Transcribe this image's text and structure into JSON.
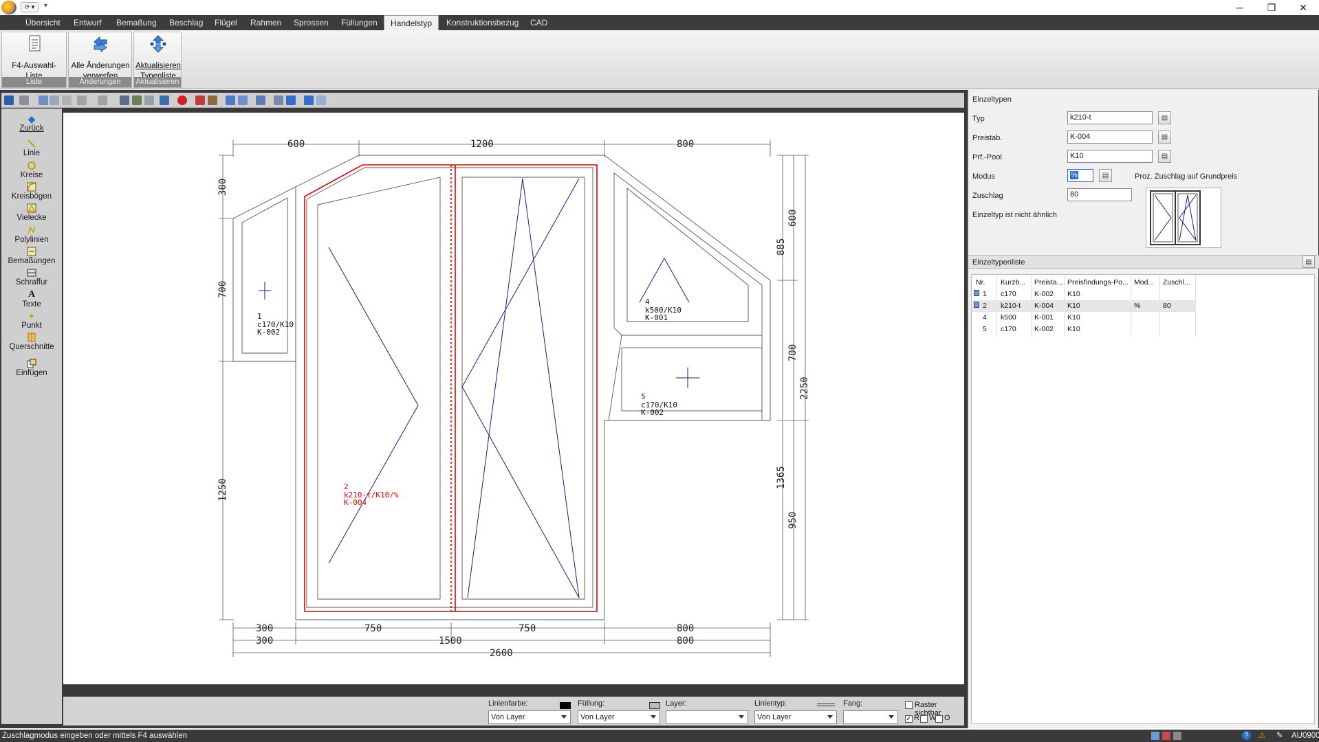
{
  "window": {
    "minimize": "─",
    "maximize": "❐",
    "close": "✕"
  },
  "quick_access": {
    "label": "⟳ ▾",
    "more": "▾"
  },
  "menu": {
    "tabs": [
      "Übersicht",
      "Entwurf",
      "Bemaßung",
      "Beschlag",
      "Flügel",
      "Rahmen",
      "Sprossen",
      "Füllungen",
      "Handelstyp",
      "Konstruktionsbezug",
      "CAD"
    ],
    "active": "Handelstyp"
  },
  "ribbon": {
    "groups": [
      {
        "caption": "Liste",
        "buttons": [
          {
            "label": "F4-Auswahl-Liste",
            "icon": "list-icon"
          }
        ]
      },
      {
        "caption": "Änderungen",
        "buttons": [
          {
            "label1": "Alle Änderungen",
            "label2": "verwerfen",
            "icon": "undo-arrows-icon"
          }
        ]
      },
      {
        "caption": "Aktualisieren",
        "buttons": [
          {
            "label1": "Aktualisieren",
            "label2": "Typenliste",
            "icon": "refresh-icon"
          }
        ]
      }
    ]
  },
  "left_tools": {
    "back": "Zurück",
    "items": [
      "Linie",
      "Kreise",
      "Kreisbögen",
      "Vielecke",
      "Polylinien",
      "Bemaßungen",
      "Schraffur",
      "Texte",
      "Punkt",
      "Querschnitte",
      "Einfügen"
    ]
  },
  "drawing": {
    "dims_top": [
      "600",
      "1200",
      "800"
    ],
    "dims_bottom1": [
      "300",
      "750",
      "750",
      "800"
    ],
    "dims_bottom2": [
      "300",
      "1500",
      "800"
    ],
    "dims_bottom3": "2600",
    "dims_left": [
      "300",
      "700",
      "1250"
    ],
    "dims_right1": [
      "600",
      "885",
      "700",
      "1365",
      "950"
    ],
    "dims_right2": "2250",
    "labels": [
      {
        "nr": "1",
        "type": "c170/K10",
        "price": "K-002"
      },
      {
        "nr": "2",
        "type": "k210-t/K10/%",
        "price": "K-004"
      },
      {
        "nr": "4",
        "type": "k500/K10",
        "price": "K-001"
      },
      {
        "nr": "5",
        "type": "c170/K10",
        "price": "K-002"
      }
    ]
  },
  "props": {
    "linienfarbe_label": "Linienfarbe:",
    "linienfarbe_value": "Von Layer",
    "fuellung_label": "Füllung:",
    "fuellung_value": "Von Layer",
    "layer_label": "Layer:",
    "layer_value": "",
    "linientyp_label": "Linientyp:",
    "linientyp_value": "Von Layer",
    "fang_label": "Fang:",
    "fang_value": "",
    "raster_label": "Raster sichtbar",
    "r": "R",
    "w": "W",
    "o": "O"
  },
  "einzeltypen": {
    "title": "Einzeltypen",
    "typ_label": "Typ",
    "typ_value": "k210-t",
    "preistab_label": "Preistab.",
    "preistab_value": "K-004",
    "pool_label": "Prf.-Pool",
    "pool_value": "K10",
    "modus_label": "Modus",
    "modus_value": "%",
    "modus_desc": "Proz. Zuschlag auf Grundpreis",
    "zuschlag_label": "Zuschlag",
    "zuschlag_value": "80",
    "hint": "Einzeltyp ist nicht ähnlich"
  },
  "liste": {
    "title": "Einzeltypenliste",
    "columns": [
      "Nr.",
      "Kurzb...",
      "Preista...",
      "Preisfindungs-Po...",
      "Mod...",
      "Zuschl..."
    ],
    "rows": [
      [
        "1",
        "c170",
        "K-002",
        "K10",
        "",
        ""
      ],
      [
        "2",
        "k210-t",
        "K-004",
        "K10",
        "%",
        "80"
      ],
      [
        "4",
        "k500",
        "K-001",
        "K10",
        "",
        ""
      ],
      [
        "5",
        "c170",
        "K-002",
        "K10",
        "",
        ""
      ]
    ]
  },
  "status": {
    "text": "Zuschlagmodus eingeben oder mittels F4 auswählen",
    "code": "AU0900"
  },
  "colors": {
    "accent_red": "#e00000",
    "drawing_blue": "#1a1a8c",
    "menu_bg": "#3c3c3c"
  }
}
